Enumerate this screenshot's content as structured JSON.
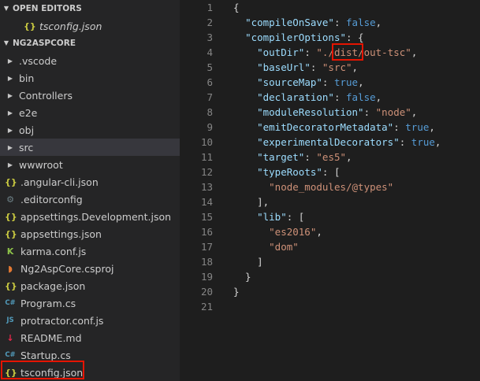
{
  "sidebar": {
    "open_editors_header": "OPEN EDITORS",
    "open_editors": [
      {
        "icon": "{}",
        "label": "tsconfig.json",
        "icon_name": "json-icon"
      }
    ],
    "project_header": "NG2ASPCORE",
    "folders": [
      {
        "label": ".vscode"
      },
      {
        "label": "bin"
      },
      {
        "label": "Controllers"
      },
      {
        "label": "e2e"
      },
      {
        "label": "obj"
      },
      {
        "label": "src"
      },
      {
        "label": "wwwroot"
      }
    ],
    "files": [
      {
        "icon": "{}",
        "label": ".angular-cli.json",
        "icon_name": "json-icon",
        "color": "#cbcb41"
      },
      {
        "icon": "⚙",
        "label": ".editorconfig",
        "icon_name": "config-icon",
        "color": "#6d8086"
      },
      {
        "icon": "{}",
        "label": "appsettings.Development.json",
        "icon_name": "json-icon",
        "color": "#cbcb41"
      },
      {
        "icon": "{}",
        "label": "appsettings.json",
        "icon_name": "json-icon",
        "color": "#cbcb41"
      },
      {
        "icon": "K",
        "label": "karma.conf.js",
        "icon_name": "karma-icon",
        "color": "#8dc149"
      },
      {
        "icon": "◗",
        "label": "Ng2AspCore.csproj",
        "icon_name": "rss-icon",
        "color": "#e37933"
      },
      {
        "icon": "{}",
        "label": "package.json",
        "icon_name": "json-icon",
        "color": "#cbcb41"
      },
      {
        "icon": "C#",
        "label": "Program.cs",
        "icon_name": "csharp-icon",
        "color": "#519aba"
      },
      {
        "icon": "JS",
        "label": "protractor.conf.js",
        "icon_name": "js-icon",
        "color": "#519aba"
      },
      {
        "icon": "↓",
        "label": "README.md",
        "icon_name": "markdown-icon",
        "color": "#e8274b"
      },
      {
        "icon": "C#",
        "label": "Startup.cs",
        "icon_name": "csharp-icon",
        "color": "#519aba"
      },
      {
        "icon": "{}",
        "label": "tsconfig.json",
        "icon_name": "json-icon",
        "color": "#cbcb41"
      }
    ]
  },
  "editor": {
    "lines": [
      {
        "n": "1",
        "parts": [
          {
            "t": "{",
            "c": "p"
          }
        ]
      },
      {
        "n": "2",
        "parts": [
          {
            "t": "  ",
            "c": "p"
          },
          {
            "t": "\"compileOnSave\"",
            "c": "k"
          },
          {
            "t": ": ",
            "c": "p"
          },
          {
            "t": "false",
            "c": "b"
          },
          {
            "t": ",",
            "c": "p"
          }
        ]
      },
      {
        "n": "3",
        "parts": [
          {
            "t": "  ",
            "c": "p"
          },
          {
            "t": "\"compilerOptions\"",
            "c": "k"
          },
          {
            "t": ": {",
            "c": "p"
          }
        ]
      },
      {
        "n": "4",
        "parts": [
          {
            "t": "    ",
            "c": "p"
          },
          {
            "t": "\"outDir\"",
            "c": "k"
          },
          {
            "t": ": ",
            "c": "p"
          },
          {
            "t": "\"./dist/out-tsc\"",
            "c": "s"
          },
          {
            "t": ",",
            "c": "p"
          }
        ]
      },
      {
        "n": "5",
        "parts": [
          {
            "t": "    ",
            "c": "p"
          },
          {
            "t": "\"baseUrl\"",
            "c": "k"
          },
          {
            "t": ": ",
            "c": "p"
          },
          {
            "t": "\"src\"",
            "c": "s"
          },
          {
            "t": ",",
            "c": "p"
          }
        ]
      },
      {
        "n": "6",
        "parts": [
          {
            "t": "    ",
            "c": "p"
          },
          {
            "t": "\"sourceMap\"",
            "c": "k"
          },
          {
            "t": ": ",
            "c": "p"
          },
          {
            "t": "true",
            "c": "b"
          },
          {
            "t": ",",
            "c": "p"
          }
        ]
      },
      {
        "n": "7",
        "parts": [
          {
            "t": "    ",
            "c": "p"
          },
          {
            "t": "\"declaration\"",
            "c": "k"
          },
          {
            "t": ": ",
            "c": "p"
          },
          {
            "t": "false",
            "c": "b"
          },
          {
            "t": ",",
            "c": "p"
          }
        ]
      },
      {
        "n": "8",
        "parts": [
          {
            "t": "    ",
            "c": "p"
          },
          {
            "t": "\"moduleResolution\"",
            "c": "k"
          },
          {
            "t": ": ",
            "c": "p"
          },
          {
            "t": "\"node\"",
            "c": "s"
          },
          {
            "t": ",",
            "c": "p"
          }
        ]
      },
      {
        "n": "9",
        "parts": [
          {
            "t": "    ",
            "c": "p"
          },
          {
            "t": "\"emitDecoratorMetadata\"",
            "c": "k"
          },
          {
            "t": ": ",
            "c": "p"
          },
          {
            "t": "true",
            "c": "b"
          },
          {
            "t": ",",
            "c": "p"
          }
        ]
      },
      {
        "n": "10",
        "parts": [
          {
            "t": "    ",
            "c": "p"
          },
          {
            "t": "\"experimentalDecorators\"",
            "c": "k"
          },
          {
            "t": ": ",
            "c": "p"
          },
          {
            "t": "true",
            "c": "b"
          },
          {
            "t": ",",
            "c": "p"
          }
        ]
      },
      {
        "n": "11",
        "parts": [
          {
            "t": "    ",
            "c": "p"
          },
          {
            "t": "\"target\"",
            "c": "k"
          },
          {
            "t": ": ",
            "c": "p"
          },
          {
            "t": "\"es5\"",
            "c": "s"
          },
          {
            "t": ",",
            "c": "p"
          }
        ]
      },
      {
        "n": "12",
        "parts": [
          {
            "t": "    ",
            "c": "p"
          },
          {
            "t": "\"typeRoots\"",
            "c": "k"
          },
          {
            "t": ": [",
            "c": "p"
          }
        ]
      },
      {
        "n": "13",
        "parts": [
          {
            "t": "      ",
            "c": "p"
          },
          {
            "t": "\"node_modules/@types\"",
            "c": "s"
          }
        ]
      },
      {
        "n": "14",
        "parts": [
          {
            "t": "    ],",
            "c": "p"
          }
        ]
      },
      {
        "n": "15",
        "parts": [
          {
            "t": "    ",
            "c": "p"
          },
          {
            "t": "\"lib\"",
            "c": "k"
          },
          {
            "t": ": [",
            "c": "p"
          }
        ]
      },
      {
        "n": "16",
        "parts": [
          {
            "t": "      ",
            "c": "p"
          },
          {
            "t": "\"es2016\"",
            "c": "s"
          },
          {
            "t": ",",
            "c": "p"
          }
        ]
      },
      {
        "n": "17",
        "parts": [
          {
            "t": "      ",
            "c": "p"
          },
          {
            "t": "\"dom\"",
            "c": "s"
          }
        ]
      },
      {
        "n": "18",
        "parts": [
          {
            "t": "    ]",
            "c": "p"
          }
        ]
      },
      {
        "n": "19",
        "parts": [
          {
            "t": "  }",
            "c": "p"
          }
        ]
      },
      {
        "n": "20",
        "parts": [
          {
            "t": "}",
            "c": "p"
          }
        ]
      },
      {
        "n": "21",
        "parts": []
      }
    ]
  }
}
